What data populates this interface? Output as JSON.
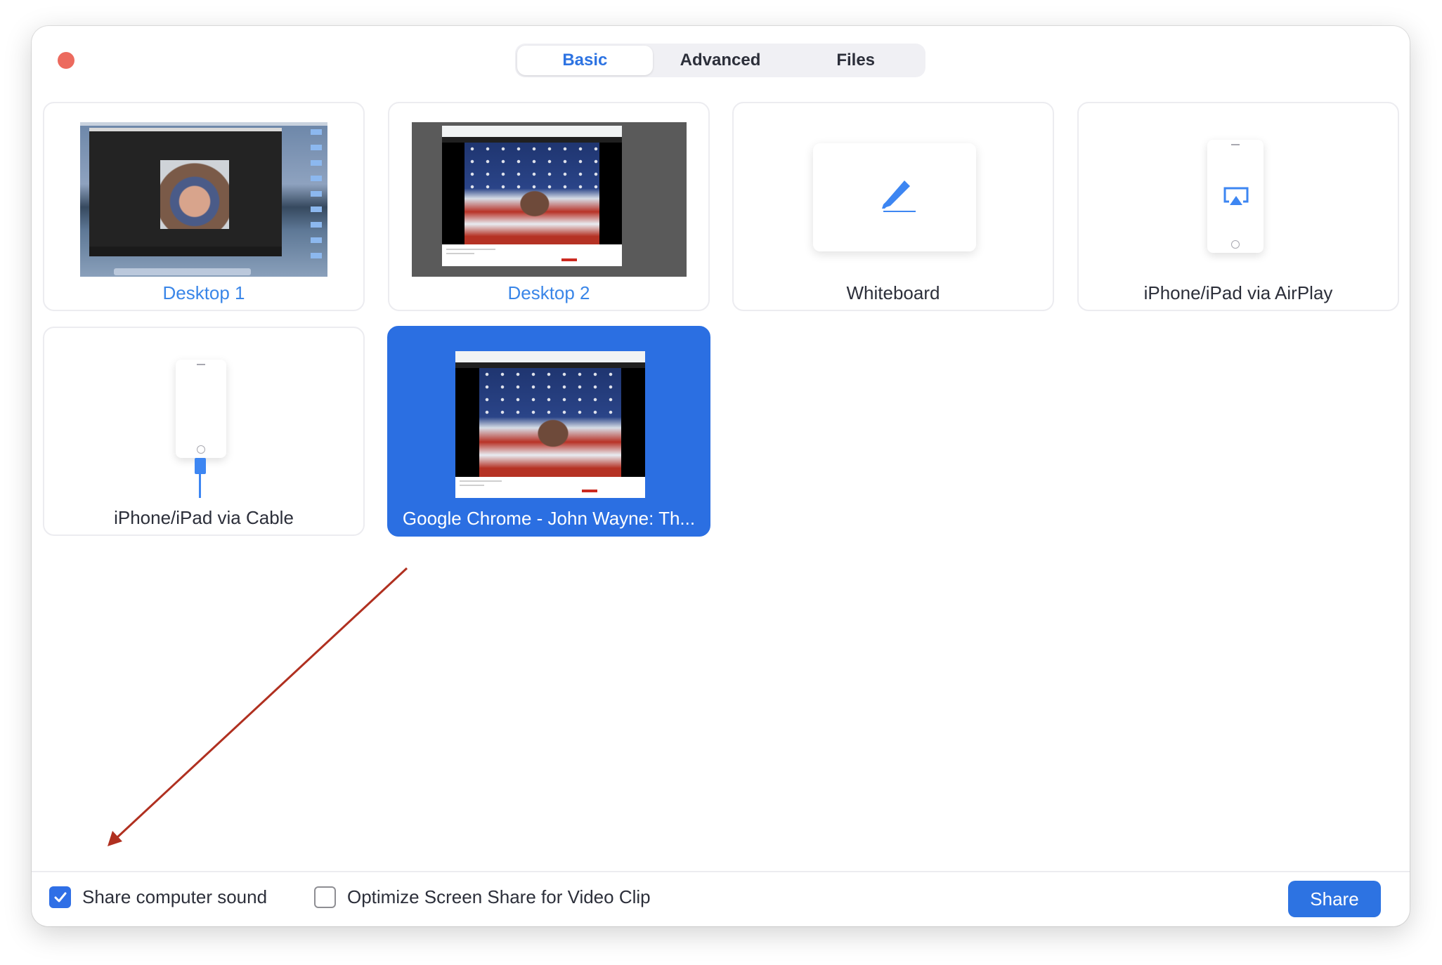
{
  "window": {
    "close_button": "close"
  },
  "tabs": [
    {
      "label": "Basic",
      "active": true
    },
    {
      "label": "Advanced",
      "active": false
    },
    {
      "label": "Files",
      "active": false
    }
  ],
  "share_options": [
    {
      "label": "Desktop 1",
      "type": "screen",
      "selected": false
    },
    {
      "label": "Desktop 2",
      "type": "screen",
      "selected": false
    },
    {
      "label": "Whiteboard",
      "type": "whiteboard",
      "selected": false
    },
    {
      "label": "iPhone/iPad via AirPlay",
      "type": "airplay",
      "selected": false
    },
    {
      "label": "iPhone/iPad via Cable",
      "type": "cable",
      "selected": false
    },
    {
      "label": "Google Chrome - John Wayne: Th...",
      "type": "window",
      "selected": true
    }
  ],
  "footer": {
    "share_sound": {
      "label": "Share computer sound",
      "checked": true
    },
    "optimize_video": {
      "label": "Optimize Screen Share for Video Clip",
      "checked": false
    },
    "share_button": "Share"
  },
  "annotation": {
    "type": "arrow",
    "color": "#b03020",
    "points_to": "Share computer sound"
  },
  "colors": {
    "accent": "#2d73e2",
    "selected_card": "#2b6fe2",
    "label_blue": "#3a86e8",
    "close_red": "#ec6a5e"
  }
}
